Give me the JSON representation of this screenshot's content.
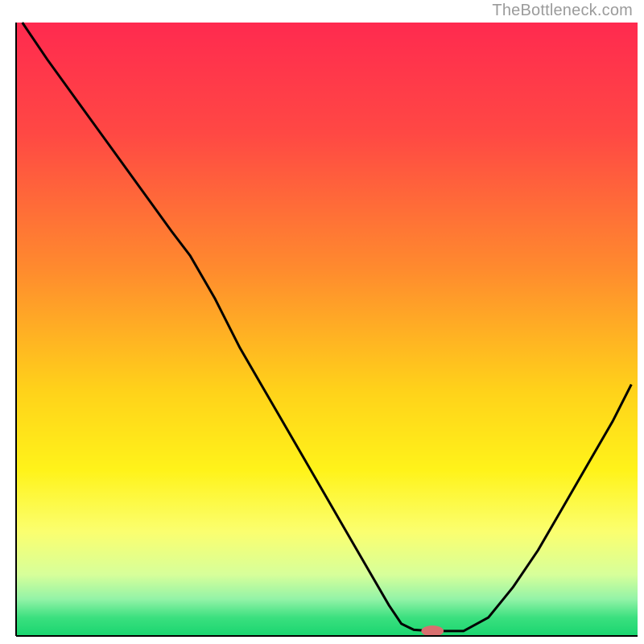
{
  "attribution": "TheBottleneck.com",
  "colors": {
    "curve": "#000000",
    "marker": "#d86f6f",
    "axis": "#000000",
    "gradient_stops": [
      {
        "offset": 0.0,
        "color": "#ff2a4f"
      },
      {
        "offset": 0.18,
        "color": "#ff4844"
      },
      {
        "offset": 0.4,
        "color": "#ff8a2e"
      },
      {
        "offset": 0.6,
        "color": "#ffd21a"
      },
      {
        "offset": 0.73,
        "color": "#fff31a"
      },
      {
        "offset": 0.83,
        "color": "#fbff6f"
      },
      {
        "offset": 0.9,
        "color": "#d7ff9a"
      },
      {
        "offset": 0.94,
        "color": "#93f3a7"
      },
      {
        "offset": 0.97,
        "color": "#3be07f"
      },
      {
        "offset": 1.0,
        "color": "#19d56f"
      }
    ]
  },
  "chart_data": {
    "type": "line",
    "title": "",
    "xlabel": "",
    "ylabel": "",
    "xlim": [
      0,
      100
    ],
    "ylim": [
      0,
      100
    ],
    "legend": false,
    "grid": false,
    "x": [
      1,
      5,
      10,
      15,
      20,
      25,
      28,
      32,
      36,
      40,
      44,
      48,
      52,
      56,
      60,
      62,
      64,
      67,
      72,
      76,
      80,
      84,
      88,
      92,
      96,
      99
    ],
    "values": [
      100,
      94,
      87,
      80,
      73,
      66,
      62,
      55,
      47,
      40,
      33,
      26,
      19,
      12,
      5,
      2,
      1,
      0.8,
      0.8,
      3,
      8,
      14,
      21,
      28,
      35,
      41
    ],
    "marker": {
      "x": 67,
      "y": 0.8,
      "rx": 1.8,
      "ry": 0.9
    }
  }
}
